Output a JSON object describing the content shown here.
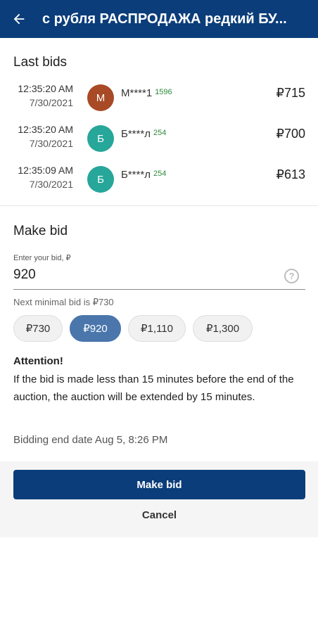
{
  "header": {
    "title": "с рубля РАСПРОДАЖА редкий БУ..."
  },
  "last_bids": {
    "title": "Last bids",
    "items": [
      {
        "time": "12:35:20 AM",
        "date": "7/30/2021",
        "avatar_letter": "М",
        "avatar_color": "#a84a25",
        "bidder": "М****1",
        "rating": "1596",
        "amount": "₽715"
      },
      {
        "time": "12:35:20 AM",
        "date": "7/30/2021",
        "avatar_letter": "Б",
        "avatar_color": "#27a69a",
        "bidder": "Б****л",
        "rating": "254",
        "amount": "₽700"
      },
      {
        "time": "12:35:09 AM",
        "date": "7/30/2021",
        "avatar_letter": "Б",
        "avatar_color": "#27a69a",
        "bidder": "Б****л",
        "rating": "254",
        "amount": "₽613"
      }
    ]
  },
  "make_bid": {
    "title": "Make bid",
    "input_label": "Enter your bid, ₽",
    "input_value": "920",
    "help_icon": "question-circle-icon",
    "min_hint": "Next minimal bid is ₽730",
    "chips": [
      {
        "label": "₽730",
        "selected": false
      },
      {
        "label": "₽920",
        "selected": true
      },
      {
        "label": "₽1,110",
        "selected": false
      },
      {
        "label": "₽1,300",
        "selected": false
      }
    ],
    "attention_title": "Attention!",
    "attention_text": "If the bid is made less than 15 minutes before the end of the auction, the auction will be extended by 15 minutes.",
    "end_date": "Bidding end date Aug 5, 8:26 PM"
  },
  "actions": {
    "make_bid_label": "Make bid",
    "cancel_label": "Cancel"
  },
  "colors": {
    "primary": "#0b3d7a",
    "chip_selected": "#4a76ac",
    "rating_green": "#2e8b3a"
  }
}
